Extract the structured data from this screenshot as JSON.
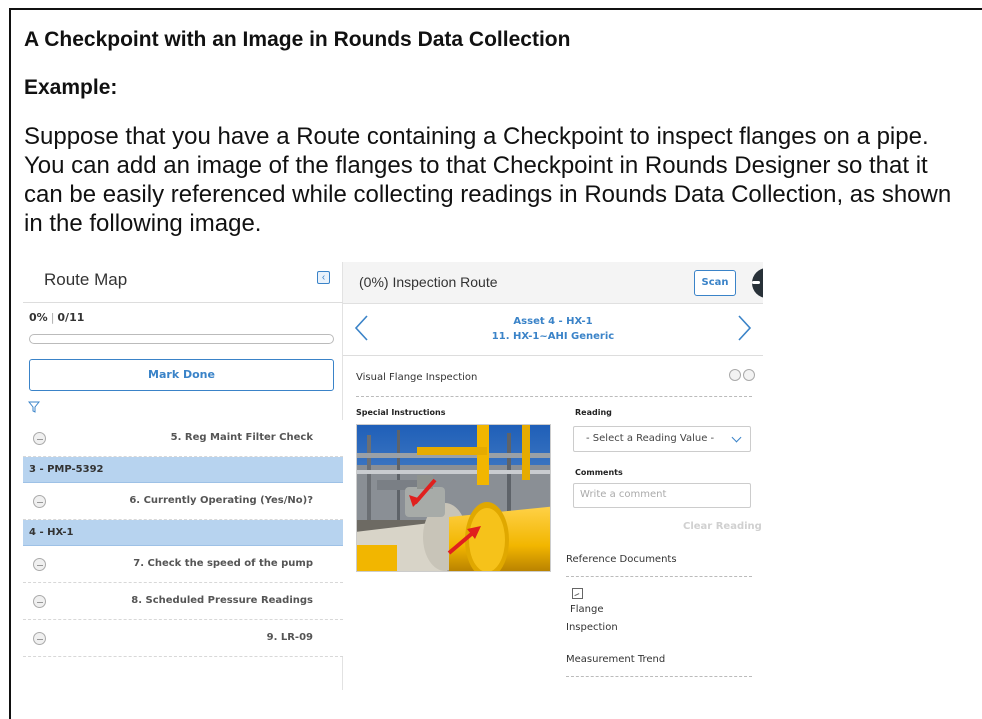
{
  "doc": {
    "title": "A Checkpoint with an Image in Rounds Data Collection",
    "subtitle": "Example:",
    "paragraph": "Suppose that you have a Route containing a Checkpoint to inspect flanges on a pipe. You can add an image of the flanges to that Checkpoint in Rounds Designer so that it can be easily referenced while collecting readings in Rounds Data Collection, as shown in the following image."
  },
  "route_map": {
    "title": "Route Map",
    "progress_percent": "0%",
    "progress_count": "0/11",
    "progress_fraction": 0,
    "mark_done_label": "Mark Done",
    "items": [
      {
        "type": "checkpoint",
        "label": "5. Reg Maint Filter Check"
      },
      {
        "type": "group",
        "label": "3 - PMP-5392"
      },
      {
        "type": "checkpoint",
        "label": "6. Currently Operating (Yes/No)?"
      },
      {
        "type": "group",
        "label": "4 - HX-1"
      },
      {
        "type": "checkpoint",
        "label": "7. Check the speed of the pump"
      },
      {
        "type": "checkpoint",
        "label": "8. Scheduled Pressure Readings"
      },
      {
        "type": "checkpoint",
        "label": "9. LR-09"
      }
    ]
  },
  "inspection": {
    "title": "(0%) Inspection Route",
    "scan_label": "Scan",
    "asset_line1": "Asset 4 - HX-1",
    "asset_line2": "11. HX-1~AHI Generic",
    "checkpoint_name": "Visual Flange Inspection",
    "special_instructions_label": "Special Instructions",
    "reading_label": "Reading",
    "reading_select_value": "- Select a Reading Value -",
    "comments_label": "Comments",
    "comment_placeholder": "Write a comment",
    "clear_reading_label": "Clear Reading",
    "reference_documents_label": "Reference Documents",
    "reference_doc_line1": "Flange",
    "reference_doc_line2": "Inspection",
    "measurement_trend_label": "Measurement Trend"
  },
  "colors": {
    "accent": "#3a83c8",
    "group_row": "#b7d3ef",
    "pipe_yellow": "#f2b600",
    "arrow_red": "#e0201e"
  },
  "icons": {
    "collapse": "collapse-panel-icon",
    "filter": "filter-icon",
    "prev": "chevron-left-icon",
    "next": "chevron-right-icon",
    "image": "image-icon"
  }
}
